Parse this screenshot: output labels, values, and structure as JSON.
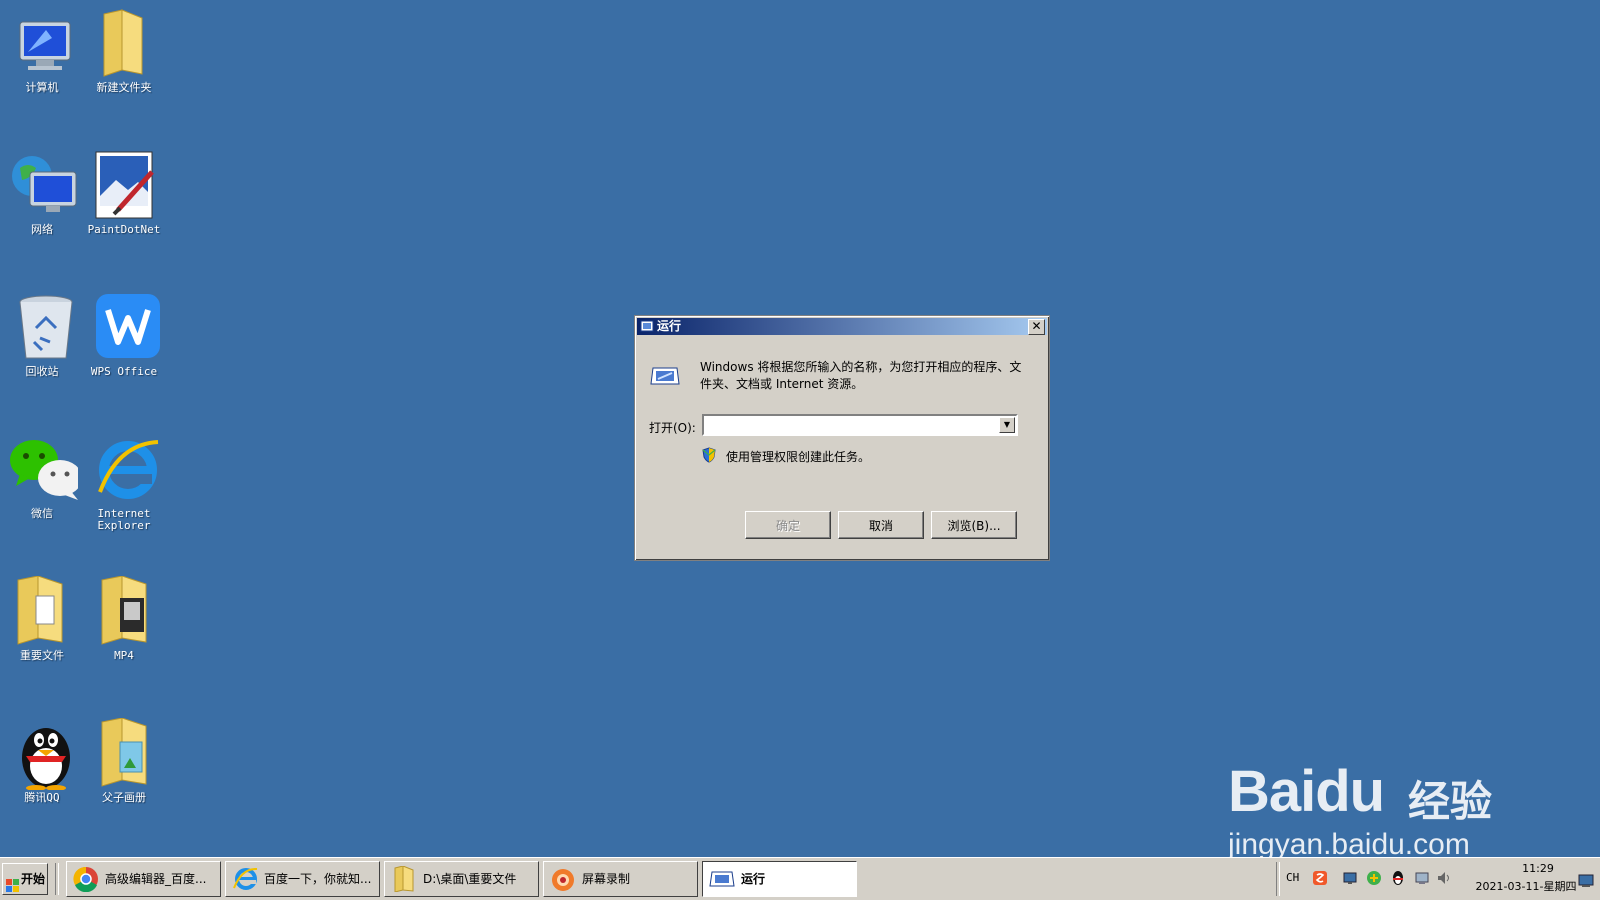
{
  "desktop": {
    "background_color": "#3a6ea5",
    "icons": [
      {
        "label": "计算机",
        "icon": "computer-icon"
      },
      {
        "label": "新建文件夹",
        "icon": "folder-icon"
      },
      {
        "label": "网络",
        "icon": "network-icon"
      },
      {
        "label": "PaintDotNet",
        "icon": "paintdotnet-icon"
      },
      {
        "label": "回收站",
        "icon": "recycle-bin-icon"
      },
      {
        "label": "WPS Office",
        "icon": "wps-office-icon"
      },
      {
        "label": "微信",
        "icon": "wechat-icon"
      },
      {
        "label": "Internet\nExplorer",
        "icon": "internet-explorer-icon"
      },
      {
        "label": "重要文件",
        "icon": "folder-icon"
      },
      {
        "label": "MP4",
        "icon": "folder-icon"
      },
      {
        "label": "腾讯QQ",
        "icon": "qq-icon"
      },
      {
        "label": "父子画册",
        "icon": "folder-icon"
      }
    ]
  },
  "run_dialog": {
    "title": "运行",
    "description": "Windows 将根据您所输入的名称，为您打开相应的程序、文件夹、文档或 Internet 资源。",
    "open_label": "打开(O):",
    "open_value": "",
    "admin_note": "使用管理权限创建此任务。",
    "buttons": {
      "ok": "确定",
      "ok_enabled": false,
      "cancel": "取消",
      "browse": "浏览(B)..."
    }
  },
  "taskbar": {
    "start_label": "开始",
    "tasks": [
      {
        "label": "高级编辑器_百度...",
        "icon": "chrome-icon",
        "active": false
      },
      {
        "label": "百度一下，你就知...",
        "icon": "internet-explorer-icon",
        "active": false
      },
      {
        "label": "D:\\桌面\\重要文件",
        "icon": "folder-icon",
        "active": false
      },
      {
        "label": "屏幕录制",
        "icon": "screen-recorder-icon",
        "active": false
      },
      {
        "label": "运行",
        "icon": "run-icon",
        "active": true
      }
    ],
    "tray": {
      "language": "CH",
      "icons": [
        "sogou-input-icon",
        "network-status-icon",
        "security-icon",
        "qq-tray-icon",
        "display-icon",
        "volume-icon"
      ],
      "time": "11:29",
      "date": "2021-03-11-星期四"
    }
  },
  "watermark": {
    "brand": "Baidu",
    "cn": "经验",
    "url": "jingyan.baidu.com"
  }
}
